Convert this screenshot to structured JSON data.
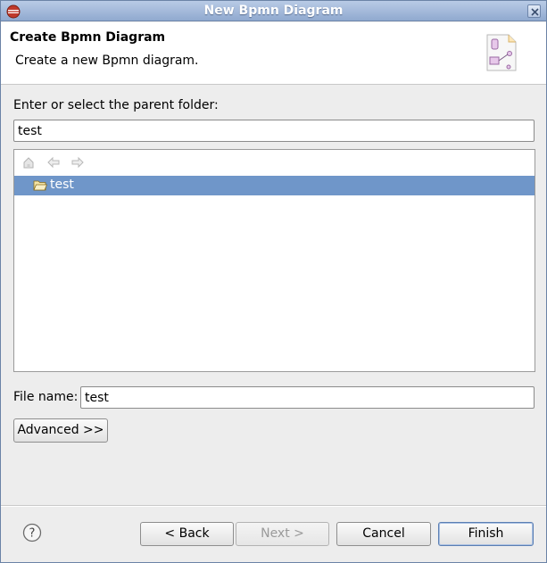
{
  "window": {
    "title": "New Bpmn Diagram"
  },
  "header": {
    "title": "Create Bpmn Diagram",
    "description": "Create a new Bpmn diagram."
  },
  "parent_folder": {
    "label": "Enter or select the parent folder:",
    "value": "test"
  },
  "tree": {
    "toolbar": [
      "home-icon",
      "back-arrow-icon",
      "forward-arrow-icon"
    ],
    "items": [
      {
        "label": "test",
        "selected": true
      }
    ]
  },
  "file_name": {
    "label": "File name:",
    "value": "test"
  },
  "buttons": {
    "advanced": "Advanced >>",
    "back": "< Back",
    "next": "Next >",
    "cancel": "Cancel",
    "finish": "Finish"
  },
  "colors": {
    "titlebar": "#9fb6d9",
    "selection": "#6f96c9",
    "background": "#ededed"
  }
}
